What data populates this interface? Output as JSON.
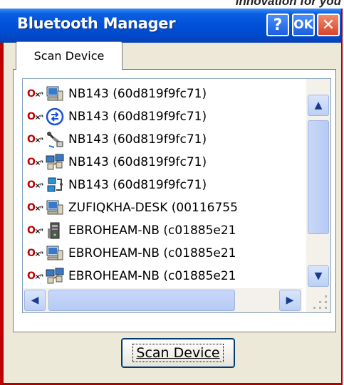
{
  "top_strip_text": "innovation for you",
  "window": {
    "title": "Bluetooth Manager",
    "help_label": "?",
    "ok_label": "OK",
    "close_label": "✕"
  },
  "tabs": [
    {
      "label": "Scan Device",
      "active": true
    }
  ],
  "devices": [
    {
      "key": "O",
      "key_sub": "×ⁿ",
      "icon": "computer-icon",
      "label": "NB143 (60d819f9fc71)"
    },
    {
      "key": "O",
      "key_sub": "×ⁿ",
      "icon": "network-icon",
      "label": "NB143 (60d819f9fc71)"
    },
    {
      "key": "O",
      "key_sub": "×ⁿ",
      "icon": "modem-icon",
      "label": "NB143 (60d819f9fc71)"
    },
    {
      "key": "O",
      "key_sub": "×ⁿ",
      "icon": "network-pc-icon",
      "label": "NB143 (60d819f9fc71)"
    },
    {
      "key": "O",
      "key_sub": "×ⁿ",
      "icon": "serial-port-icon",
      "label": "NB143 (60d819f9fc71)"
    },
    {
      "key": "O",
      "key_sub": "×ⁿ",
      "icon": "computer-icon",
      "label": "ZUFIQKHA-DESK (00116755"
    },
    {
      "key": "O",
      "key_sub": "×ⁿ",
      "icon": "tower-pc-icon",
      "label": "EBROHEAM-NB (c01885e21"
    },
    {
      "key": "O",
      "key_sub": "×ⁿ",
      "icon": "computer-icon",
      "label": "EBROHEAM-NB (c01885e21"
    },
    {
      "key": "O",
      "key_sub": "×ⁿ",
      "icon": "network-pc-icon",
      "label": "EBROHEAM-NB (c01885e21"
    }
  ],
  "scan_button_label": "Scan Device",
  "colors": {
    "titlebar": "#0050d8",
    "accent_red": "#c00000"
  }
}
